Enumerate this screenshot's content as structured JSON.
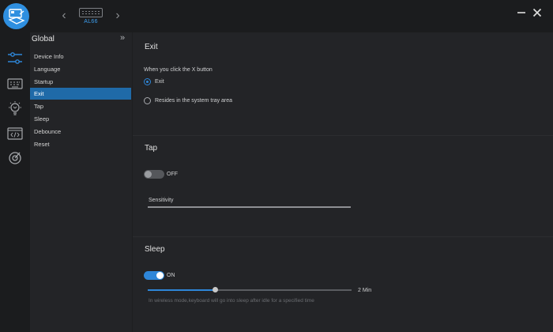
{
  "device": {
    "name": "AL66"
  },
  "menu": {
    "title": "Global",
    "items": [
      {
        "label": "Device Info"
      },
      {
        "label": "Language"
      },
      {
        "label": "Startup"
      },
      {
        "label": "Exit",
        "active": true
      },
      {
        "label": "Tap"
      },
      {
        "label": "Sleep"
      },
      {
        "label": "Debounce"
      },
      {
        "label": "Reset"
      }
    ]
  },
  "exit": {
    "title": "Exit",
    "question": "When you click the X button",
    "options": [
      {
        "label": "Exit",
        "selected": true
      },
      {
        "label": "Resides in the system tray area",
        "selected": false
      }
    ]
  },
  "tap": {
    "title": "Tap",
    "toggle_state": "OFF",
    "sensitivity_label": "Sensitivity"
  },
  "sleep": {
    "title": "Sleep",
    "toggle_state": "ON",
    "slider_value": "2 Min",
    "slider_fraction": 0.33,
    "hint": "In wireless mode,keyboard will go into sleep after idle for a specified time"
  },
  "colors": {
    "accent": "#2e86d8",
    "active_menu": "#1f6aa8",
    "logo": "#2f8fe0",
    "background": "#1d1e20",
    "panel": "#232427"
  },
  "icons": [
    "app-logo-icon",
    "chevron-left-icon",
    "keyboard-icon",
    "chevron-right-icon",
    "minimize-icon",
    "close-icon",
    "sliders-icon",
    "keyboard-icon",
    "lightbulb-icon",
    "code-icon",
    "target-icon",
    "double-chevron-right-icon"
  ]
}
